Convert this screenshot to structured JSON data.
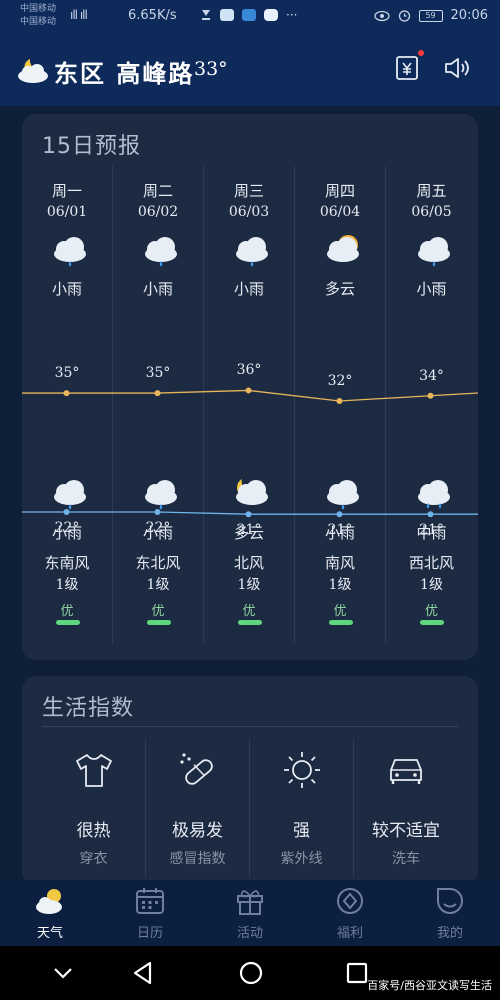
{
  "status_bar": {
    "carrier_1": "中国移动",
    "carrier_2": "中国移动",
    "signal": "ıll ıll",
    "speed": "6.65K/s",
    "time": "20:06",
    "battery": "59"
  },
  "header": {
    "location": "东区 高峰路",
    "temperature": "33°",
    "weather_icon": "partly-cloudy-night-icon"
  },
  "forecast": {
    "title": "15日预报",
    "days": [
      {
        "weekday": "周一",
        "date": "06/01",
        "day_condition": "小雨",
        "high": "35°",
        "low": "22°",
        "night_condition": "小雨",
        "wind_dir": "东南风",
        "wind_level": "1级",
        "air_quality": "优",
        "day_icon": "light-rain-icon",
        "night_icon": "light-rain-icon"
      },
      {
        "weekday": "周二",
        "date": "06/02",
        "day_condition": "小雨",
        "high": "35°",
        "low": "22°",
        "night_condition": "小雨",
        "wind_dir": "东北风",
        "wind_level": "1级",
        "air_quality": "优",
        "day_icon": "light-rain-icon",
        "night_icon": "light-rain-icon"
      },
      {
        "weekday": "周三",
        "date": "06/03",
        "day_condition": "小雨",
        "high": "36°",
        "low": "21°",
        "night_condition": "多云",
        "wind_dir": "北风",
        "wind_level": "1级",
        "air_quality": "优",
        "day_icon": "light-rain-icon",
        "night_icon": "cloudy-night-icon"
      },
      {
        "weekday": "周四",
        "date": "06/04",
        "day_condition": "多云",
        "high": "32°",
        "low": "21°",
        "night_condition": "小雨",
        "wind_dir": "南风",
        "wind_level": "1级",
        "air_quality": "优",
        "day_icon": "partly-cloudy-icon",
        "night_icon": "light-rain-icon"
      },
      {
        "weekday": "周五",
        "date": "06/05",
        "day_condition": "小雨",
        "high": "34°",
        "low": "21°",
        "night_condition": "中雨",
        "wind_dir": "西北风",
        "wind_level": "1级",
        "air_quality": "优",
        "day_icon": "light-rain-icon",
        "night_icon": "moderate-rain-icon"
      }
    ],
    "high_values": [
      35,
      35,
      36,
      32,
      34
    ],
    "low_values": [
      22,
      22,
      21,
      21,
      21
    ],
    "high_color": "#e7b55a",
    "low_color": "#6fb3ea",
    "air_quality_color": "#5ed67e"
  },
  "life_index": {
    "title": "生活指数",
    "items": [
      {
        "value": "很热",
        "label": "穿衣",
        "icon": "tshirt-icon"
      },
      {
        "value": "极易发",
        "label": "感冒指数",
        "icon": "pill-icon"
      },
      {
        "value": "强",
        "label": "紫外线",
        "icon": "sun-icon"
      },
      {
        "value": "较不适宜",
        "label": "洗车",
        "icon": "car-icon"
      }
    ]
  },
  "bottom_nav": {
    "items": [
      {
        "label": "天气",
        "icon": "weather-icon",
        "active": true
      },
      {
        "label": "日历",
        "icon": "calendar-icon",
        "active": false
      },
      {
        "label": "活动",
        "icon": "gift-icon",
        "active": false
      },
      {
        "label": "福利",
        "icon": "coin-icon",
        "active": false
      },
      {
        "label": "我的",
        "icon": "profile-icon",
        "active": false
      }
    ]
  },
  "watermark": "百家号/西谷亚文读写生活"
}
